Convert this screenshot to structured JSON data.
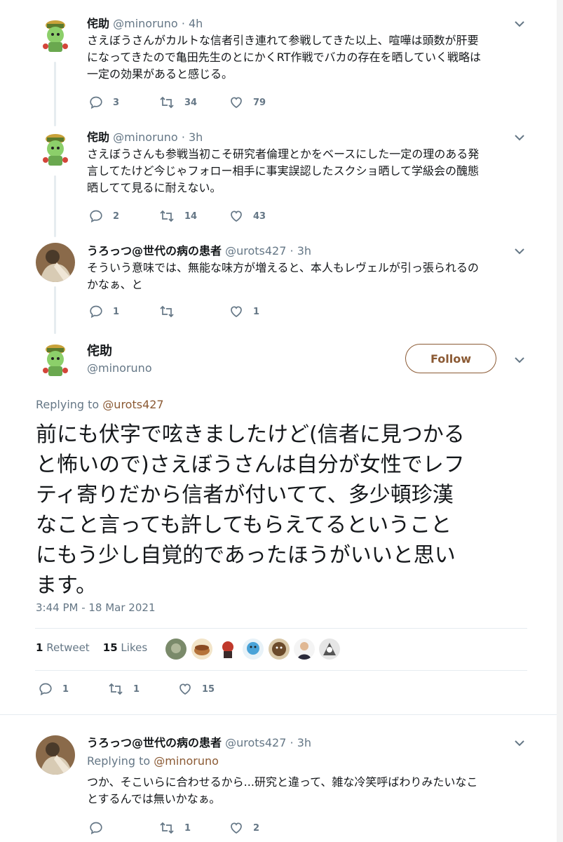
{
  "tweets": [
    {
      "name": "侘助",
      "handle": "@minoruno",
      "time": "· 4h",
      "lines": [
        "さえぼうさんがカルトな信者引き連れて参戦してきた以上、喧嘩は頭数が肝要",
        "になってきたので亀田先生のとにかくRT作戦でバカの存在を晒していく戦略は",
        "一定の効果があると感じる。"
      ],
      "replies": "3",
      "retweets": "34",
      "likes": "79"
    },
    {
      "name": "侘助",
      "handle": "@minoruno",
      "time": "· 3h",
      "lines": [
        "さえぼうさんも参戦当初こそ研究者倫理とかをベースにした一定の理のある発",
        "言してたけど今じゃフォロー相手に事実誤認したスクショ晒して学級会の醜態",
        "晒してて見るに耐えない。"
      ],
      "replies": "2",
      "retweets": "14",
      "likes": "43"
    },
    {
      "name": "うろっつ@世代の病の患者",
      "handle": "@urots427",
      "time": "· 3h",
      "lines": [
        "そういう意味では、無能な味方が増えると、本人もレヴェルが引っ張られるの",
        "かなぁ、と"
      ],
      "replies": "1",
      "retweets": "",
      "likes": "1"
    }
  ],
  "main": {
    "name": "侘助",
    "handle": "@minoruno",
    "follow_label": "Follow",
    "replying_prefix": "Replying to ",
    "replying_to": "@urots427",
    "lines": [
      "前にも伏字で呟きましたけど(信者に見つかる",
      "と怖いので)さえぼうさんは自分が女性でレフ",
      "ティ寄りだから信者が付いてて、多少頓珍漢",
      "なこと言っても許してもらえてるということ",
      "にもう少し自覚的であったほうがいいと思い",
      "ます。"
    ],
    "timestamp": "3:44 PM - 18 Mar 2021",
    "retweet_count": "1",
    "retweet_label": "Retweet",
    "likes_count": "15",
    "likes_label": "Likes",
    "replies": "1",
    "retweets": "1",
    "likes": "15"
  },
  "reply": {
    "name": "うろっつ@世代の病の患者",
    "handle": "@urots427",
    "time": "· 3h",
    "replying_prefix": "Replying to ",
    "replying_to": "@minoruno",
    "lines": [
      "つか、そこいらに合わせるから...研究と違って、雑な冷笑呼ばわりみたいなこ",
      "とするんでは無いかなぁ。"
    ],
    "replies": "",
    "retweets": "1",
    "likes": "2"
  },
  "colors": {
    "accent": "#8b5a34",
    "text": "#14171a",
    "muted": "#657786",
    "divider": "#e6ecf0"
  },
  "icons": [
    "reply-icon",
    "retweet-icon",
    "like-icon",
    "chevron-down-icon"
  ]
}
